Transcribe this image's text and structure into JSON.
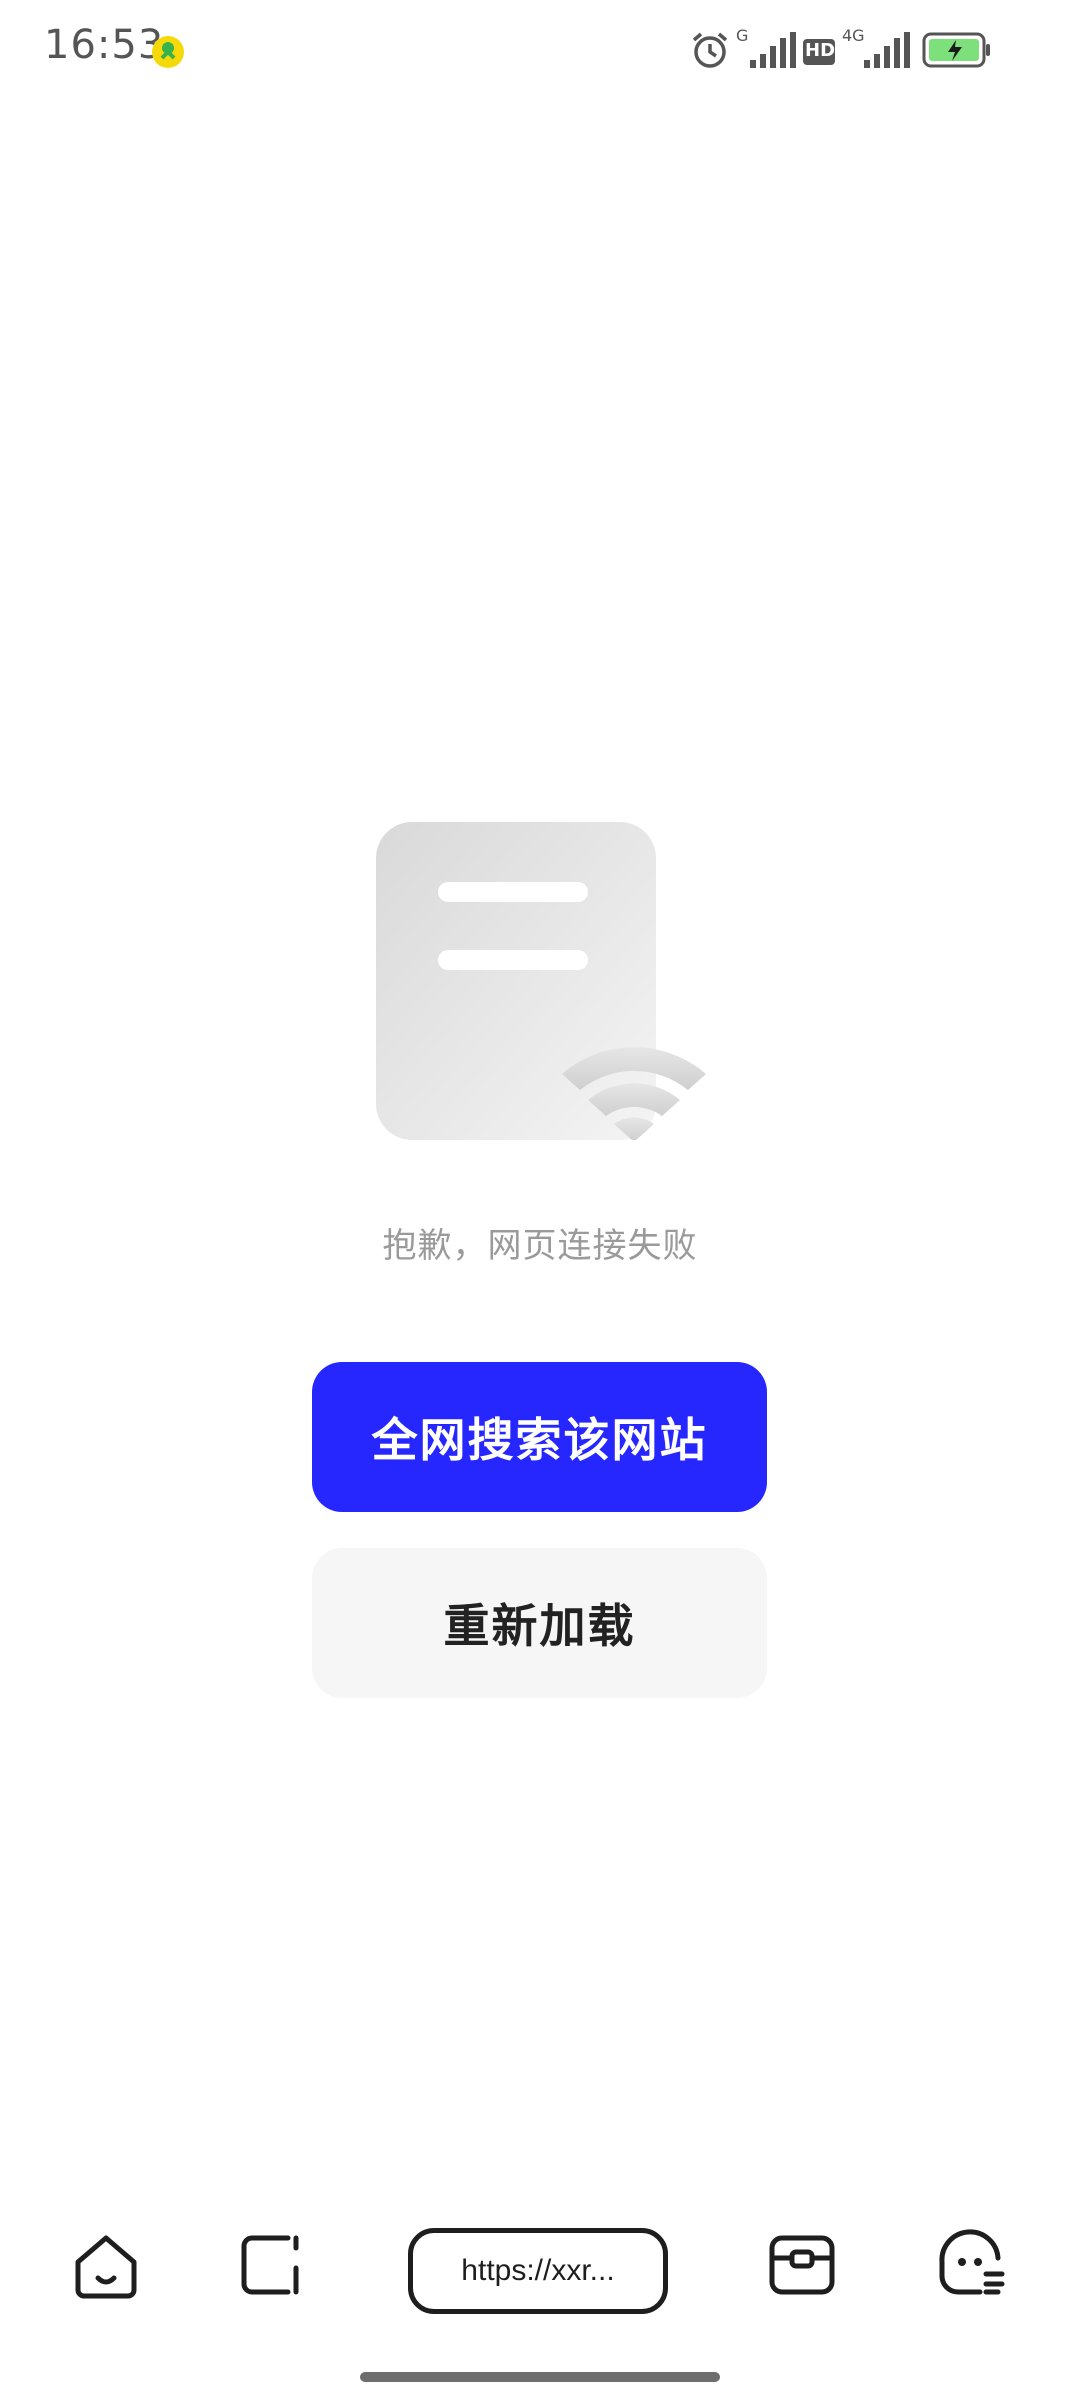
{
  "status_bar": {
    "time": "16:53",
    "signal_label_1": "G",
    "hd_label": "HD",
    "signal_label_2": "4G",
    "icons": [
      "app-notification-icon",
      "alarm-icon",
      "signal-icon",
      "hd-icon",
      "signal-4g-icon",
      "battery-charging-icon"
    ]
  },
  "error": {
    "message": "抱歉，网页连接失败",
    "illustration_icon": "page-offline-icon"
  },
  "actions": {
    "search_web_label": "全网搜索该网站",
    "reload_label": "重新加载"
  },
  "bottom_nav": {
    "url": "https://xxr...",
    "icons": [
      "home-icon",
      "tabs-icon",
      "toolbox-icon",
      "assistant-icon"
    ]
  },
  "colors": {
    "primary": "#2626ff",
    "secondary_bg": "#f6f6f6",
    "battery": "#7ee07a"
  }
}
